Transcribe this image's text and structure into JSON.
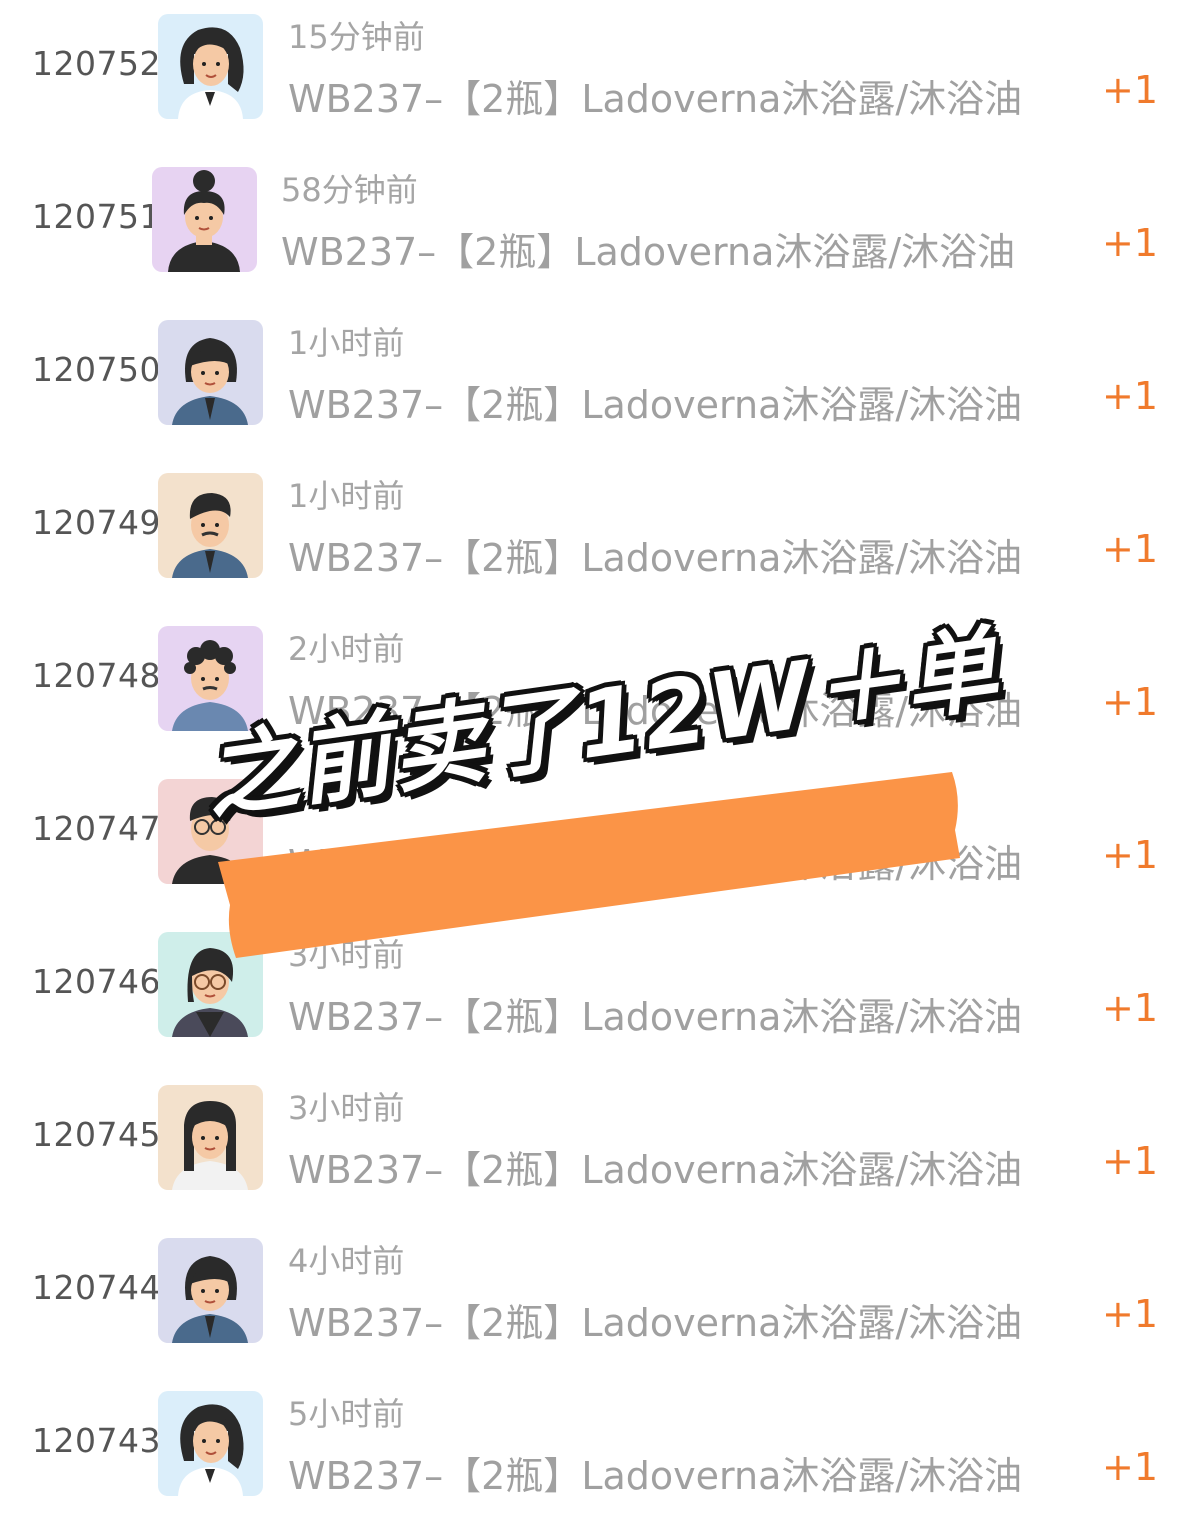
{
  "product_name": "WB237–【2瓶】Ladoverna沐浴露/沐浴油",
  "plus_label": "+1",
  "accent_color": "#f07a2c",
  "banner": {
    "text": "之前卖了12W＋单",
    "color": "#fb9447"
  },
  "orders": [
    {
      "id": "120752",
      "time": "15分钟前",
      "avatar": "avatar-woman-long-hair-icon",
      "bg": "#dbeefa"
    },
    {
      "id": "120751",
      "time": "58分钟前",
      "avatar": "avatar-woman-bun-icon",
      "bg": "#e7d3f2"
    },
    {
      "id": "120750",
      "time": "1小时前",
      "avatar": "avatar-woman-bob-icon",
      "bg": "#d9dbee"
    },
    {
      "id": "120749",
      "time": "1小时前",
      "avatar": "avatar-man-mustache-icon",
      "bg": "#f3e1cc"
    },
    {
      "id": "120748",
      "time": "2小时前",
      "avatar": "avatar-man-curly-icon",
      "bg": "#e6d4f2"
    },
    {
      "id": "120747",
      "time": "",
      "avatar": "avatar-man-glasses-icon",
      "bg": "#f3d4d4"
    },
    {
      "id": "120746",
      "time": "3小时前",
      "avatar": "avatar-woman-glasses-icon",
      "bg": "#cfeeea"
    },
    {
      "id": "120745",
      "time": "3小时前",
      "avatar": "avatar-woman-straight-hair-icon",
      "bg": "#f3e1cc"
    },
    {
      "id": "120744",
      "time": "4小时前",
      "avatar": "avatar-woman-bob-icon",
      "bg": "#d9dbee"
    },
    {
      "id": "120743",
      "time": "5小时前",
      "avatar": "avatar-woman-long-hair-icon",
      "bg": "#dbeefa"
    }
  ]
}
